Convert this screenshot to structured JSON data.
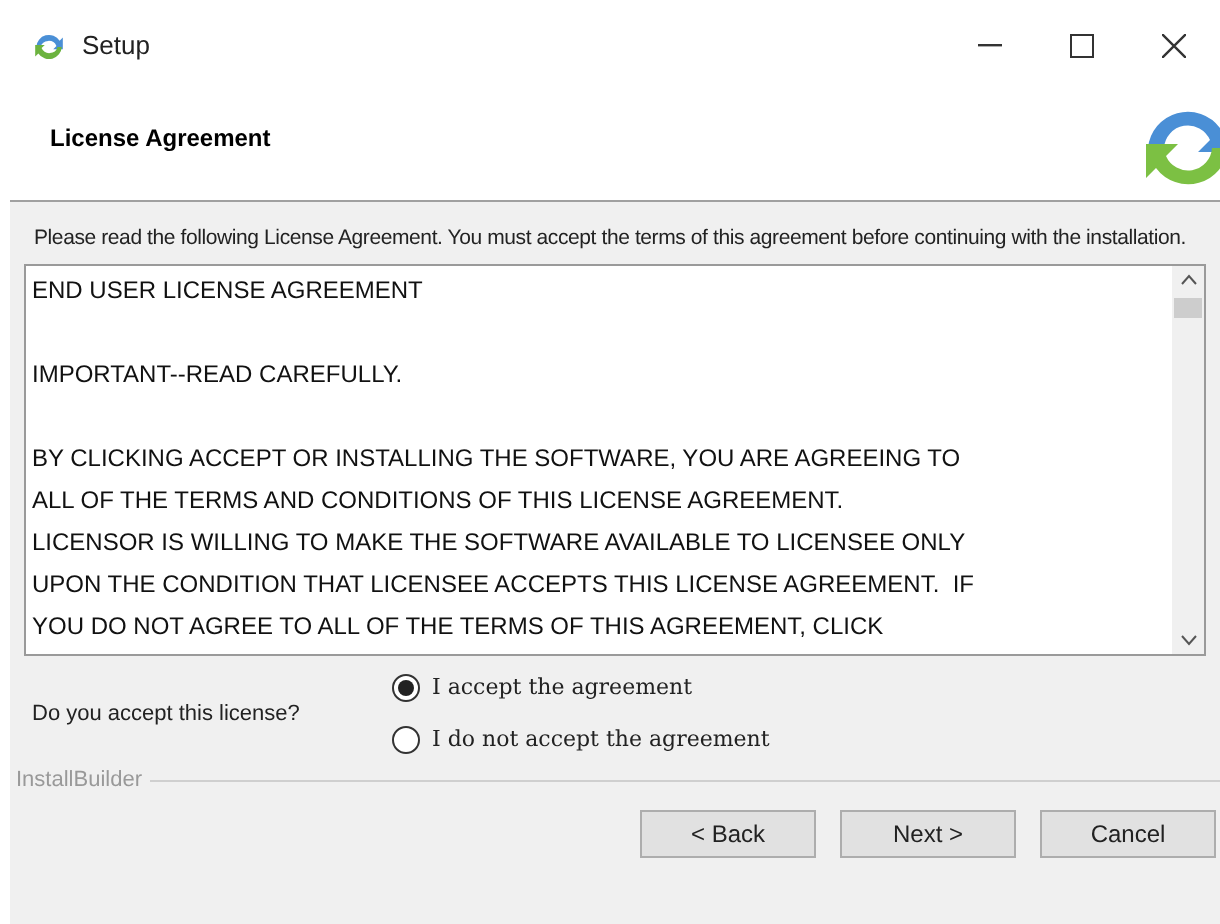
{
  "window": {
    "title": "Setup"
  },
  "header": {
    "title": "License Agreement"
  },
  "intro": "Please read the following License Agreement. You must accept the terms of this agreement before continuing with the installation.",
  "license_text": {
    "paragraphs": [
      {
        "lines": [
          "END USER LICENSE AGREEMENT"
        ]
      },
      {
        "lines": [
          "IMPORTANT--READ CAREFULLY."
        ]
      },
      {
        "lines": [
          "BY CLICKING ACCEPT OR INSTALLING THE SOFTWARE, YOU ARE AGREEING TO",
          "ALL OF THE TERMS AND CONDITIONS OF THIS LICENSE AGREEMENT.",
          "LICENSOR IS WILLING TO MAKE THE SOFTWARE AVAILABLE TO LICENSEE ONLY",
          "UPON THE CONDITION THAT LICENSEE ACCEPTS THIS LICENSE AGREEMENT.  IF",
          "YOU DO NOT AGREE TO ALL OF THE TERMS OF THIS AGREEMENT, CLICK"
        ]
      }
    ]
  },
  "question": "Do you accept this license?",
  "options": [
    {
      "label": "I accept the agreement",
      "selected": true
    },
    {
      "label": "I do not accept the agreement",
      "selected": false
    }
  ],
  "footer_label": "InstallBuilder",
  "buttons": [
    "< Back",
    "Next >",
    "Cancel"
  ]
}
